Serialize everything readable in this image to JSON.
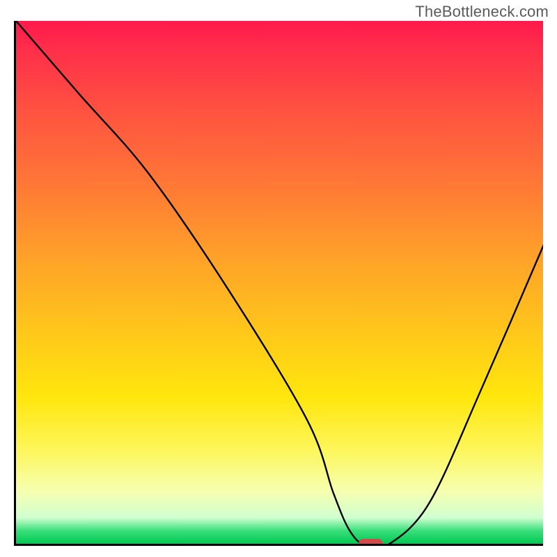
{
  "watermark": "TheBottleneck.com",
  "chart_data": {
    "type": "line",
    "title": "",
    "xlabel": "",
    "ylabel": "",
    "xlim": [
      0,
      100
    ],
    "ylim": [
      0,
      100
    ],
    "grid": false,
    "legend": false,
    "series": [
      {
        "name": "curve",
        "x": [
          0,
          12,
          25,
          40,
          55,
          60,
          63,
          66,
          70,
          78,
          88,
          100
        ],
        "y": [
          100,
          86,
          71,
          49,
          24,
          10,
          3,
          0,
          0,
          8,
          30,
          58
        ]
      }
    ],
    "marker": {
      "x": 67,
      "y": 0,
      "color": "#d24a4a",
      "shape": "pill"
    },
    "background_gradient": {
      "type": "vertical",
      "stops": [
        {
          "pos": 0.0,
          "color": "#ff1a4d"
        },
        {
          "pos": 0.18,
          "color": "#ff5440"
        },
        {
          "pos": 0.46,
          "color": "#ffa428"
        },
        {
          "pos": 0.72,
          "color": "#ffe60d"
        },
        {
          "pos": 0.9,
          "color": "#f6ffb0"
        },
        {
          "pos": 1.0,
          "color": "#00c853"
        }
      ]
    }
  }
}
